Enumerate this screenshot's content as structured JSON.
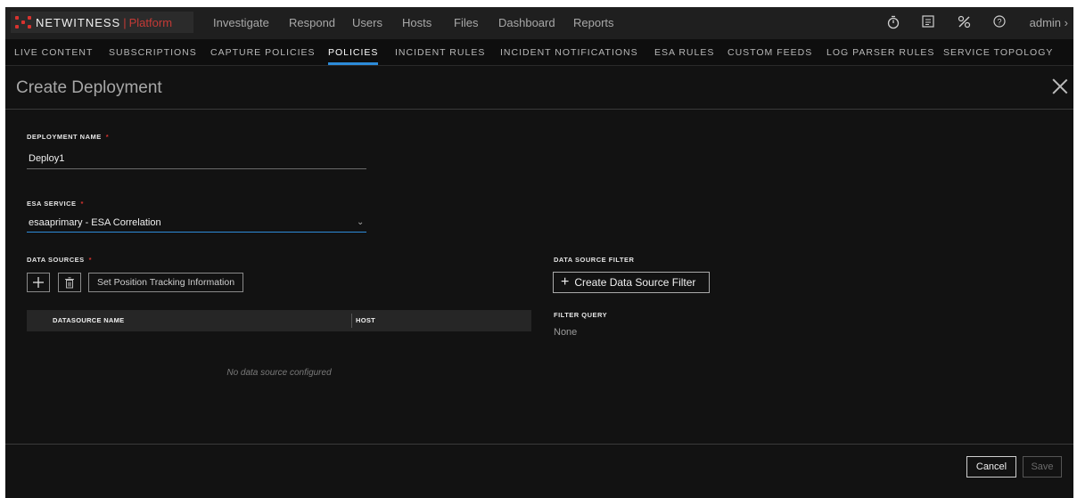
{
  "topbar": {
    "brand": "NETWITNESS",
    "product": "Platform",
    "nav": [
      "Investigate",
      "Respond",
      "Users",
      "Hosts",
      "Files",
      "Dashboard",
      "Reports"
    ],
    "user": "admin",
    "icons": [
      "timer-icon",
      "clipboard-icon",
      "tools-icon",
      "help-icon"
    ]
  },
  "subnav": {
    "tabs": [
      "LIVE CONTENT",
      "SUBSCRIPTIONS",
      "CAPTURE POLICIES",
      "POLICIES",
      "INCIDENT RULES",
      "INCIDENT NOTIFICATIONS",
      "ESA RULES",
      "CUSTOM FEEDS",
      "LOG PARSER RULES",
      "SERVICE TOPOLOGY"
    ],
    "active": "POLICIES"
  },
  "panel": {
    "title": "Create Deployment"
  },
  "form": {
    "deployment_name_label": "DEPLOYMENT NAME",
    "deployment_name_value": "Deploy1",
    "esa_service_label": "ESA SERVICE",
    "esa_service_value": "esaaprimary - ESA Correlation",
    "data_sources_label": "DATA SOURCES",
    "required_mark": "*",
    "set_position_label": "Set Position Tracking Information",
    "table": {
      "columns": [
        "DATASOURCE NAME",
        "HOST"
      ],
      "empty_message": "No data source configured"
    },
    "data_source_filter_label": "DATA SOURCE FILTER",
    "create_filter_label": "Create Data Source Filter",
    "filter_query_label": "FILTER QUERY",
    "filter_query_value": "None"
  },
  "footer": {
    "cancel_label": "Cancel",
    "save_label": "Save"
  },
  "colors": {
    "accent": "#2d8bd9",
    "brand_red": "#d9332f",
    "background": "#121212"
  }
}
